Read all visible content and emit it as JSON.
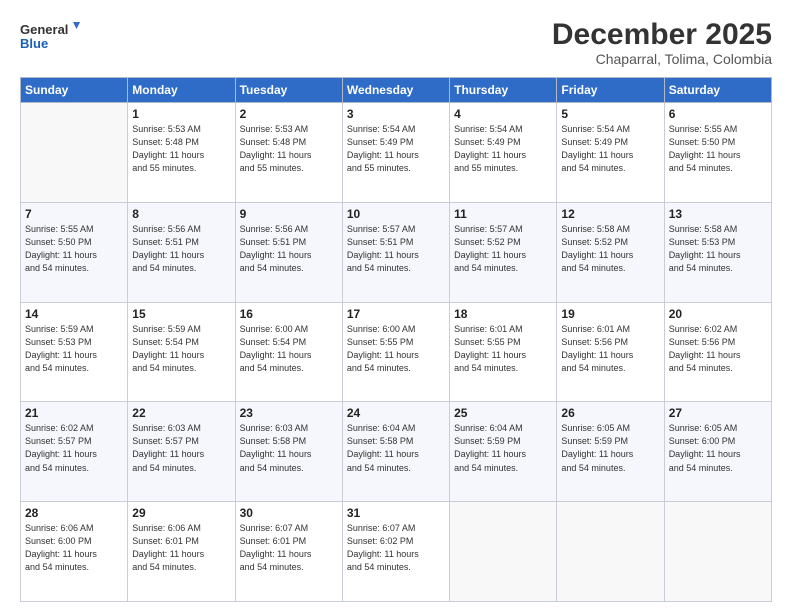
{
  "logo": {
    "line1": "General",
    "line2": "Blue"
  },
  "title": "December 2025",
  "subtitle": "Chaparral, Tolima, Colombia",
  "days_header": [
    "Sunday",
    "Monday",
    "Tuesday",
    "Wednesday",
    "Thursday",
    "Friday",
    "Saturday"
  ],
  "weeks": [
    [
      {
        "day": "",
        "info": ""
      },
      {
        "day": "1",
        "info": "Sunrise: 5:53 AM\nSunset: 5:48 PM\nDaylight: 11 hours\nand 55 minutes."
      },
      {
        "day": "2",
        "info": "Sunrise: 5:53 AM\nSunset: 5:48 PM\nDaylight: 11 hours\nand 55 minutes."
      },
      {
        "day": "3",
        "info": "Sunrise: 5:54 AM\nSunset: 5:49 PM\nDaylight: 11 hours\nand 55 minutes."
      },
      {
        "day": "4",
        "info": "Sunrise: 5:54 AM\nSunset: 5:49 PM\nDaylight: 11 hours\nand 55 minutes."
      },
      {
        "day": "5",
        "info": "Sunrise: 5:54 AM\nSunset: 5:49 PM\nDaylight: 11 hours\nand 54 minutes."
      },
      {
        "day": "6",
        "info": "Sunrise: 5:55 AM\nSunset: 5:50 PM\nDaylight: 11 hours\nand 54 minutes."
      }
    ],
    [
      {
        "day": "7",
        "info": "Sunrise: 5:55 AM\nSunset: 5:50 PM\nDaylight: 11 hours\nand 54 minutes."
      },
      {
        "day": "8",
        "info": "Sunrise: 5:56 AM\nSunset: 5:51 PM\nDaylight: 11 hours\nand 54 minutes."
      },
      {
        "day": "9",
        "info": "Sunrise: 5:56 AM\nSunset: 5:51 PM\nDaylight: 11 hours\nand 54 minutes."
      },
      {
        "day": "10",
        "info": "Sunrise: 5:57 AM\nSunset: 5:51 PM\nDaylight: 11 hours\nand 54 minutes."
      },
      {
        "day": "11",
        "info": "Sunrise: 5:57 AM\nSunset: 5:52 PM\nDaylight: 11 hours\nand 54 minutes."
      },
      {
        "day": "12",
        "info": "Sunrise: 5:58 AM\nSunset: 5:52 PM\nDaylight: 11 hours\nand 54 minutes."
      },
      {
        "day": "13",
        "info": "Sunrise: 5:58 AM\nSunset: 5:53 PM\nDaylight: 11 hours\nand 54 minutes."
      }
    ],
    [
      {
        "day": "14",
        "info": "Sunrise: 5:59 AM\nSunset: 5:53 PM\nDaylight: 11 hours\nand 54 minutes."
      },
      {
        "day": "15",
        "info": "Sunrise: 5:59 AM\nSunset: 5:54 PM\nDaylight: 11 hours\nand 54 minutes."
      },
      {
        "day": "16",
        "info": "Sunrise: 6:00 AM\nSunset: 5:54 PM\nDaylight: 11 hours\nand 54 minutes."
      },
      {
        "day": "17",
        "info": "Sunrise: 6:00 AM\nSunset: 5:55 PM\nDaylight: 11 hours\nand 54 minutes."
      },
      {
        "day": "18",
        "info": "Sunrise: 6:01 AM\nSunset: 5:55 PM\nDaylight: 11 hours\nand 54 minutes."
      },
      {
        "day": "19",
        "info": "Sunrise: 6:01 AM\nSunset: 5:56 PM\nDaylight: 11 hours\nand 54 minutes."
      },
      {
        "day": "20",
        "info": "Sunrise: 6:02 AM\nSunset: 5:56 PM\nDaylight: 11 hours\nand 54 minutes."
      }
    ],
    [
      {
        "day": "21",
        "info": "Sunrise: 6:02 AM\nSunset: 5:57 PM\nDaylight: 11 hours\nand 54 minutes."
      },
      {
        "day": "22",
        "info": "Sunrise: 6:03 AM\nSunset: 5:57 PM\nDaylight: 11 hours\nand 54 minutes."
      },
      {
        "day": "23",
        "info": "Sunrise: 6:03 AM\nSunset: 5:58 PM\nDaylight: 11 hours\nand 54 minutes."
      },
      {
        "day": "24",
        "info": "Sunrise: 6:04 AM\nSunset: 5:58 PM\nDaylight: 11 hours\nand 54 minutes."
      },
      {
        "day": "25",
        "info": "Sunrise: 6:04 AM\nSunset: 5:59 PM\nDaylight: 11 hours\nand 54 minutes."
      },
      {
        "day": "26",
        "info": "Sunrise: 6:05 AM\nSunset: 5:59 PM\nDaylight: 11 hours\nand 54 minutes."
      },
      {
        "day": "27",
        "info": "Sunrise: 6:05 AM\nSunset: 6:00 PM\nDaylight: 11 hours\nand 54 minutes."
      }
    ],
    [
      {
        "day": "28",
        "info": "Sunrise: 6:06 AM\nSunset: 6:00 PM\nDaylight: 11 hours\nand 54 minutes."
      },
      {
        "day": "29",
        "info": "Sunrise: 6:06 AM\nSunset: 6:01 PM\nDaylight: 11 hours\nand 54 minutes."
      },
      {
        "day": "30",
        "info": "Sunrise: 6:07 AM\nSunset: 6:01 PM\nDaylight: 11 hours\nand 54 minutes."
      },
      {
        "day": "31",
        "info": "Sunrise: 6:07 AM\nSunset: 6:02 PM\nDaylight: 11 hours\nand 54 minutes."
      },
      {
        "day": "",
        "info": ""
      },
      {
        "day": "",
        "info": ""
      },
      {
        "day": "",
        "info": ""
      }
    ]
  ]
}
